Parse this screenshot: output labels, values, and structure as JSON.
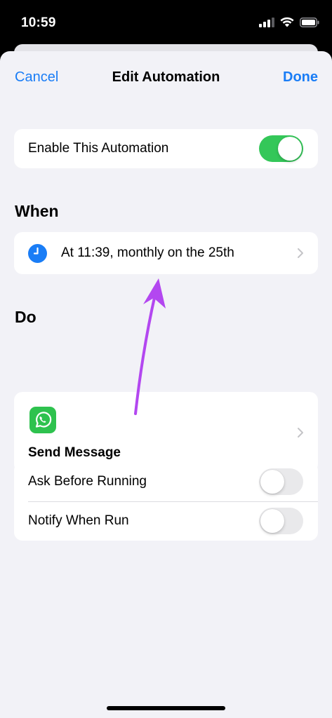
{
  "status_bar": {
    "time": "10:59"
  },
  "nav": {
    "cancel_label": "Cancel",
    "title": "Edit Automation",
    "done_label": "Done"
  },
  "enable": {
    "label": "Enable This Automation",
    "on": true
  },
  "when": {
    "header": "When",
    "trigger_text": "At 11:39, monthly on the 25th",
    "icon": "clock-icon"
  },
  "do": {
    "header": "Do",
    "action_label": "Send Message",
    "icon": "whatsapp-icon"
  },
  "options": [
    {
      "label": "Ask Before Running",
      "on": false
    },
    {
      "label": "Notify When Run",
      "on": false
    }
  ],
  "colors": {
    "accent": "#1a7df6",
    "toggle_on": "#34c759",
    "toggle_off": "#e9e9eb",
    "annotation_arrow": "#b347f0",
    "whatsapp": "#2ec24e",
    "background": "#f2f2f7"
  }
}
